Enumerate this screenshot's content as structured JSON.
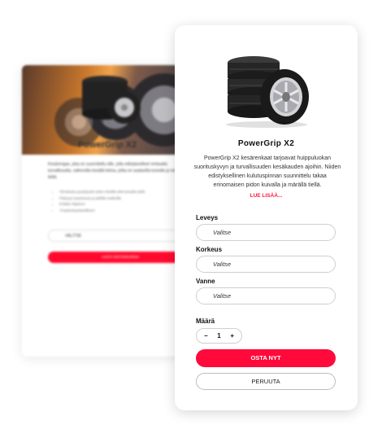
{
  "background_card": {
    "product_title": "PowerGrip X2",
    "description": "Kesärengas, joka on suunniteltu sille, jolla edistykselliset renkaalla turvallisuutta, valinnoilla kesällä tietoa, jotka on saatavilla kuivalla ja märällä tiellä.",
    "features": [
      "Tehokasta pysäytystä sekä märällä että kuivalla tiellä",
      "Pitävyys kaarteissa ja pitkillä matkoilla",
      "Erittäin hiljainen",
      "Ympäristöystävällinen"
    ],
    "select_value": "VALITSE",
    "button_label": "LISÄÄ OSTOSKORIIN"
  },
  "product": {
    "title": "PowerGrip X2",
    "description": "PowerGrip X2 kesärenkaat tarjoavat huippuluokan suorituskyvyn ja turvallisuuden kesäkauden ajoihin. Niiden edistyksellinen kulutuspinnan suunnittelu takaa erinomaisen pidon kuivalla ja märällä tiellä.",
    "read_more": "LUE LISÄÄ..."
  },
  "fields": {
    "width": {
      "label": "Leveys",
      "value": "Valitse"
    },
    "height": {
      "label": "Korkeus",
      "value": "Valitse"
    },
    "rim": {
      "label": "Vanne",
      "value": "Valitse"
    }
  },
  "quantity": {
    "label": "Määrä",
    "minus": "−",
    "value": "1",
    "plus": "+"
  },
  "actions": {
    "buy_label": "OSTA NYT",
    "cancel_label": "PERUUTA"
  },
  "colors": {
    "accent": "#ff0a3a",
    "read_more": "#ff1744"
  }
}
